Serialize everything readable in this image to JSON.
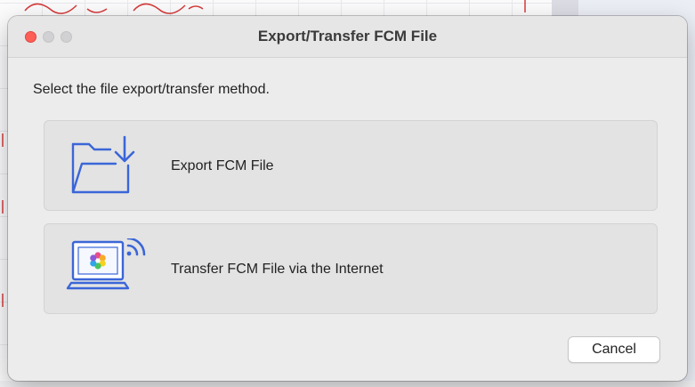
{
  "dialog": {
    "title": "Export/Transfer FCM File",
    "instruction": "Select the file export/transfer method.",
    "options": [
      {
        "label": "Export FCM File",
        "icon": "folder-download-icon"
      },
      {
        "label": "Transfer FCM File via the Internet",
        "icon": "laptop-wifi-icon"
      }
    ],
    "cancel_label": "Cancel"
  },
  "window_controls": {
    "close": "close-button",
    "minimize": "minimize-button",
    "zoom": "zoom-button"
  },
  "colors": {
    "accent_icon": "#3b66d8",
    "close_dot": "#fe5f57",
    "dialog_bg": "#ececec",
    "option_bg": "#e3e3e3",
    "swirl_lines": "#d63a3a"
  }
}
